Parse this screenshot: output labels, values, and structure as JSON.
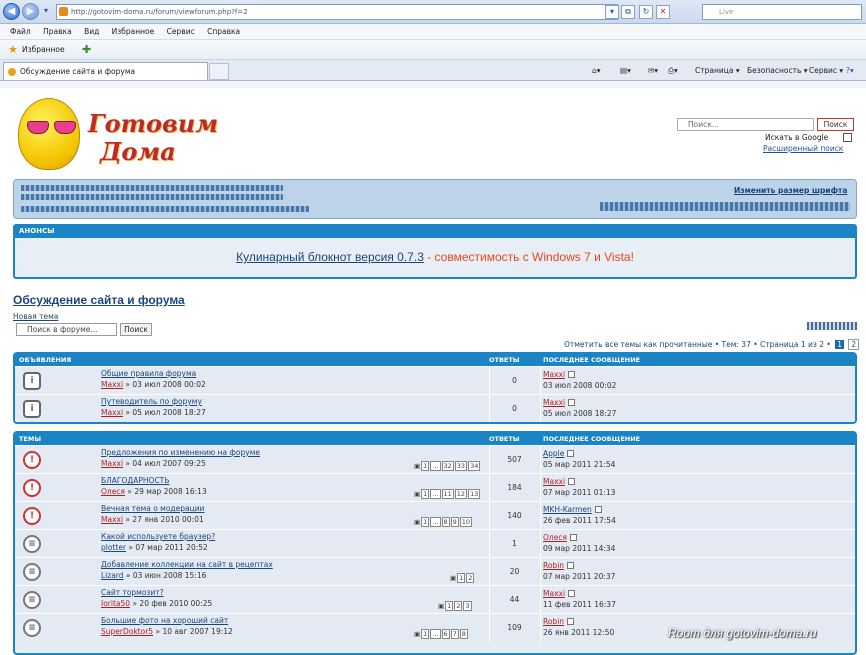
{
  "browser": {
    "url": "http://gotovim-doma.ru/forum/viewforum.php?f=2",
    "search_placeholder": "Live",
    "menu": [
      "Файл",
      "Правка",
      "Вид",
      "Избранное",
      "Сервис",
      "Справка"
    ],
    "favorites_label": "Избранное",
    "tab_label": "Обсуждение сайта и форума",
    "commands": [
      "Страница",
      "Безопасность",
      "Сервис"
    ]
  },
  "site": {
    "logo_line1": "Готовим",
    "logo_line2": "Дома",
    "search_placeholder": "Поиск...",
    "search_button": "Поиск",
    "google_label": "Искать в Google",
    "advanced_search": "Расширенный поиск",
    "resize_font": "Изменить размер шрифта"
  },
  "announcement": {
    "header": "АНОНСЫ",
    "link_text": "Кулинарный блокнот версия 0.7.3",
    "rest_text": " - совместимость с Windows 7 и Vista!"
  },
  "forum": {
    "title": "Обсуждение сайта и форума",
    "new_topic": "Новая тема",
    "search_placeholder": "Поиск в форуме...",
    "search_button": "Поиск",
    "pager_text": "Отметить все темы как прочитанные • Тем: 37 • Страница 1 из 2 •",
    "page_current": "1",
    "page_next": "2"
  },
  "announcements_table": {
    "col_title": "ОБЪЯВЛЕНИЯ",
    "col_replies": "ОТВЕТЫ",
    "col_last": "ПОСЛЕДНЕЕ СООБЩЕНИЕ",
    "rows": [
      {
        "title": "Общие правила форума",
        "author": "Maxxi",
        "date": "» 03 июл 2008 00:02",
        "replies": "0",
        "last_user": "Maxxi",
        "last_date": "03 июл 2008 00:02"
      },
      {
        "title": "Путеводитель по форуму",
        "author": "Maxxi",
        "date": "» 05 июл 2008 18:27",
        "replies": "0",
        "last_user": "Maxxi",
        "last_date": "05 июл 2008 18:27"
      }
    ]
  },
  "topics_table": {
    "col_title": "ТЕМЫ",
    "col_replies": "ОТВЕТЫ",
    "col_last": "ПОСЛЕДНЕЕ СООБЩЕНИЕ",
    "rows": [
      {
        "title": "Предложения по изменению на форуме",
        "author": "Maxxi",
        "date": "» 04 июл 2007 09:25",
        "pages": [
          "1",
          "...",
          "32",
          "33",
          "34"
        ],
        "replies": "507",
        "last_user": "Apple",
        "last_date": "05 мар 2011 21:54"
      },
      {
        "title": "БЛАГОДАРНОСТЬ",
        "author": "Олеся",
        "date": "» 29 мар 2008 16:13",
        "pages": [
          "1",
          "...",
          "11",
          "12",
          "13"
        ],
        "replies": "184",
        "last_user": "Maxxi",
        "last_date": "07 мар 2011 01:13"
      },
      {
        "title": "Вечная тема о модерации",
        "author": "Maxxi",
        "date": "» 27 янв 2010 00:01",
        "pages": [
          "1",
          "...",
          "8",
          "9",
          "10"
        ],
        "replies": "140",
        "last_user": "MKH-Karmen",
        "last_date": "26 фев 2011 17:54"
      },
      {
        "title": "Какой используете браузер?",
        "author": "plotter",
        "date": "» 07 мар 2011 20:52",
        "pages": [],
        "replies": "1",
        "last_user": "Олеся",
        "last_date": "09 мар 2011 14:34"
      },
      {
        "title": "Добавление коллекции на сайт в рецептах",
        "author": "Lizard",
        "date": "» 03 июн 2008 15:16",
        "pages": [
          "1",
          "2"
        ],
        "replies": "20",
        "last_user": "Robin",
        "last_date": "07 мар 2011 20:37"
      },
      {
        "title": "Сайт тормозит?",
        "author": "Iorita50",
        "date": "» 20 фев 2010 00:25",
        "pages": [
          "1",
          "2",
          "3"
        ],
        "replies": "44",
        "last_user": "Maxxi",
        "last_date": "11 фев 2011 16:37"
      },
      {
        "title": "Большие фото на хороший сайт",
        "author": "SuperDoktor5",
        "date": "» 10 авг 2007 19:12",
        "pages": [
          "1",
          "...",
          "6",
          "7",
          "8"
        ],
        "replies": "109",
        "last_user": "Robin",
        "last_date": "26 янв 2011 12:50"
      }
    ]
  },
  "watermark": "Room для gotovim-doma.ru"
}
